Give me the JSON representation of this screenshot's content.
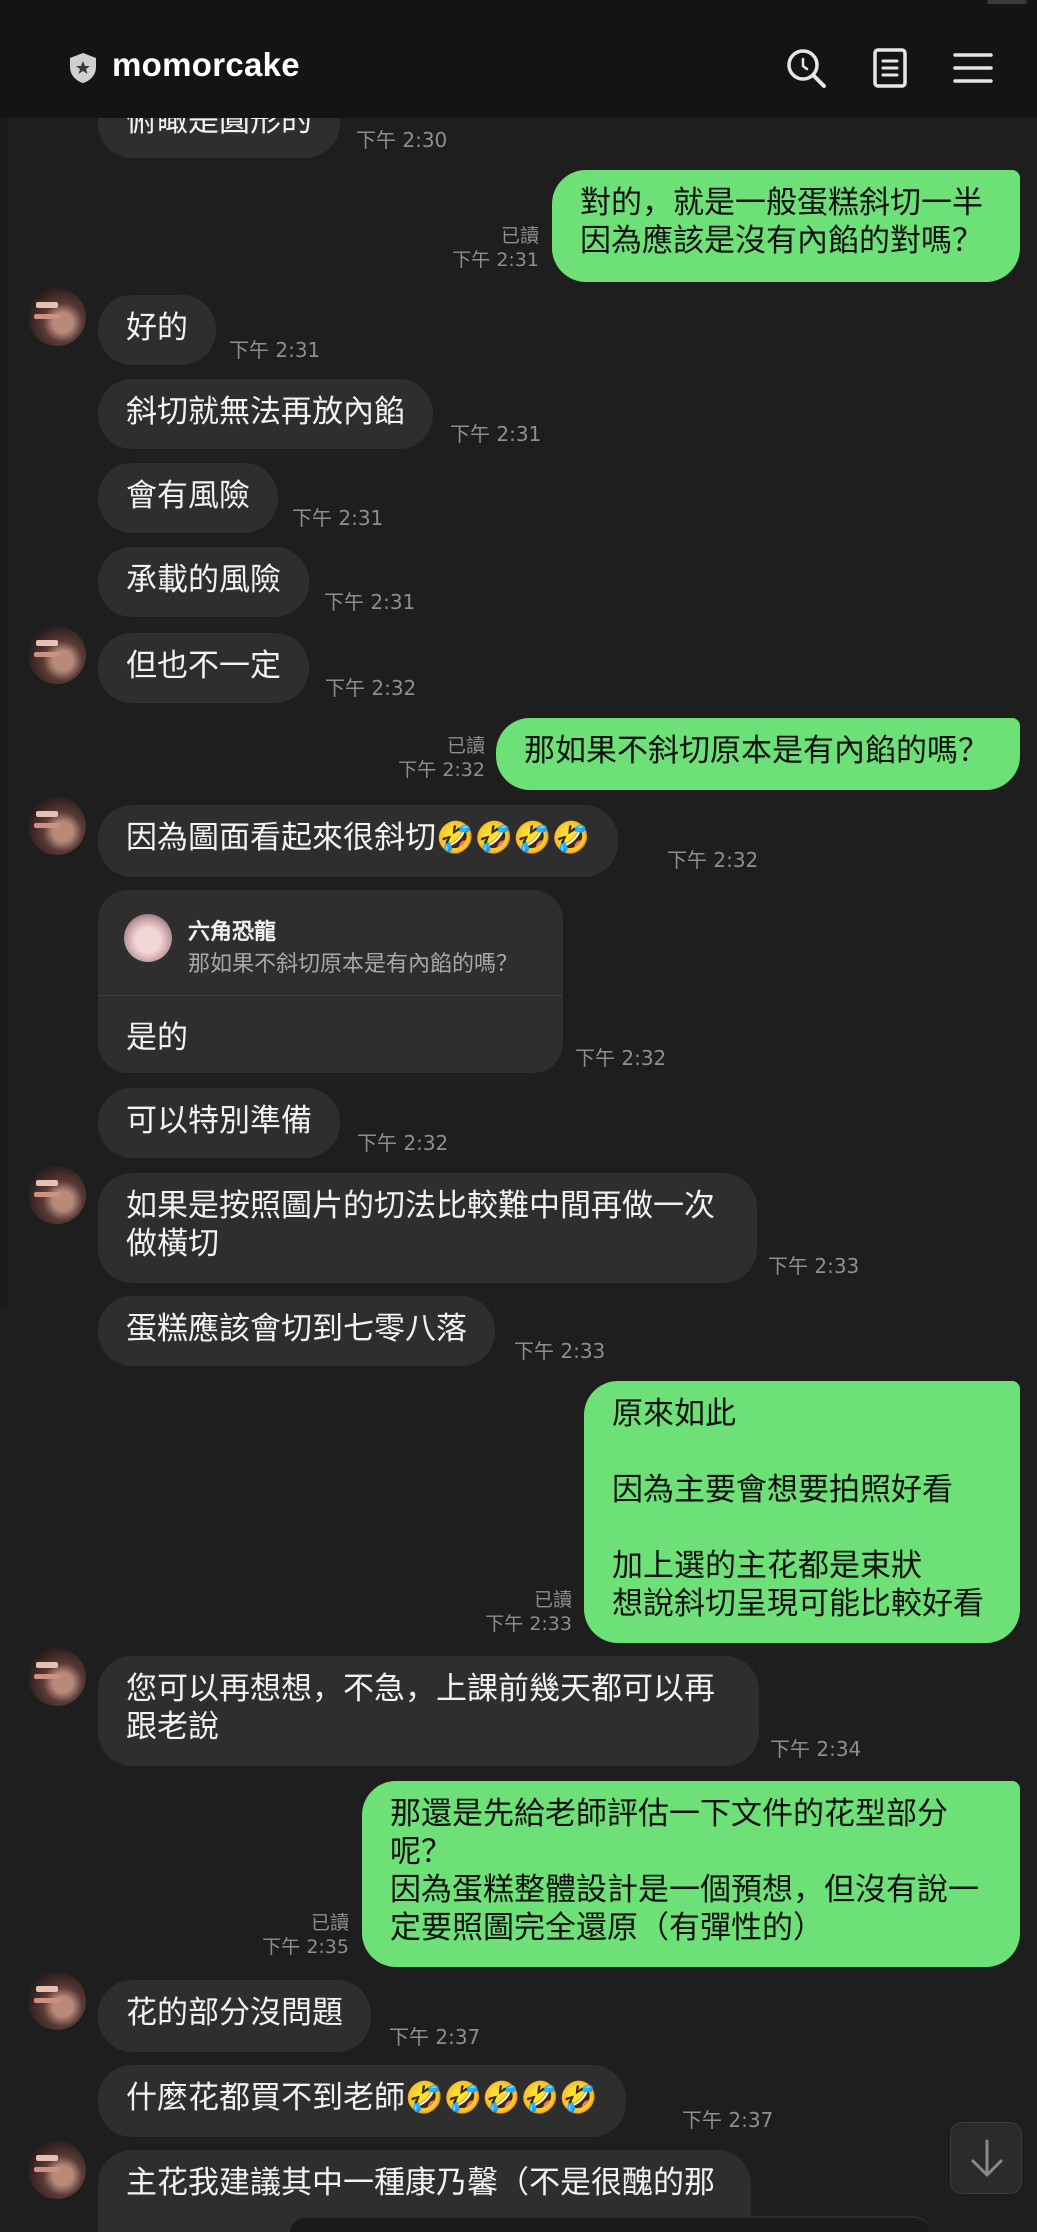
{
  "header": {
    "title": "momorcake",
    "search_icon": "search-icon",
    "notes_icon": "notes-icon",
    "menu_icon": "menu-icon"
  },
  "messages": {
    "m0": {
      "text": "俯瞰是圓形的",
      "time": "下午 2:30"
    },
    "m1": {
      "text": "對的，就是一般蛋糕斜切一半\n因為應該是沒有內餡的對嗎？",
      "read": "已讀",
      "time": "下午 2:31"
    },
    "m2": {
      "text": "好的",
      "time": "下午 2:31"
    },
    "m3": {
      "text": "斜切就無法再放內餡",
      "time": "下午 2:31"
    },
    "m4": {
      "text": "會有風險",
      "time": "下午 2:31"
    },
    "m5": {
      "text": "承載的風險",
      "time": "下午 2:31"
    },
    "m6": {
      "text": "但也不一定",
      "time": "下午 2:32"
    },
    "m7": {
      "text": "那如果不斜切原本是有內餡的嗎？",
      "read": "已讀",
      "time": "下午 2:32"
    },
    "m8": {
      "text": "因為圖面看起來很斜切🤣🤣🤣🤣",
      "time": "下午 2:32"
    },
    "m9": {
      "reply_name": "六角恐龍",
      "reply_quote": "那如果不斜切原本是有內餡的嗎？",
      "text": "是的",
      "time": "下午 2:32"
    },
    "m10": {
      "text": "可以特別準備",
      "time": "下午 2:32"
    },
    "m11": {
      "text": "如果是按照圖片的切法比較難中間再做一次\n做橫切",
      "time": "下午 2:33"
    },
    "m12": {
      "text": "蛋糕應該會切到七零八落",
      "time": "下午 2:33"
    },
    "m13": {
      "text": "原來如此\n\n因為主要會想要拍照好看\n\n加上選的主花都是束狀\n想說斜切呈現可能比較好看",
      "read": "已讀",
      "time": "下午 2:33"
    },
    "m14": {
      "text": "您可以再想想，不急，上課前幾天都可以再\n跟老說",
      "time": "下午 2:34"
    },
    "m15": {
      "text": "那還是先給老師評估一下文件的花型部分\n呢？\n因為蛋糕整體設計是一個預想，但沒有說一\n定要照圖完全還原（有彈性的）",
      "read": "已讀",
      "time": "下午 2:35"
    },
    "m16": {
      "text": "花的部分沒問題",
      "time": "下午 2:37"
    },
    "m17": {
      "text": "什麼花都買不到老師🤣🤣🤣🤣🤣",
      "time": "下午 2:37"
    },
    "m18": {
      "text": "主花我建議其中一種康乃馨（不是很醜的那"
    }
  },
  "scroll_button_icon": "arrow-down-icon"
}
